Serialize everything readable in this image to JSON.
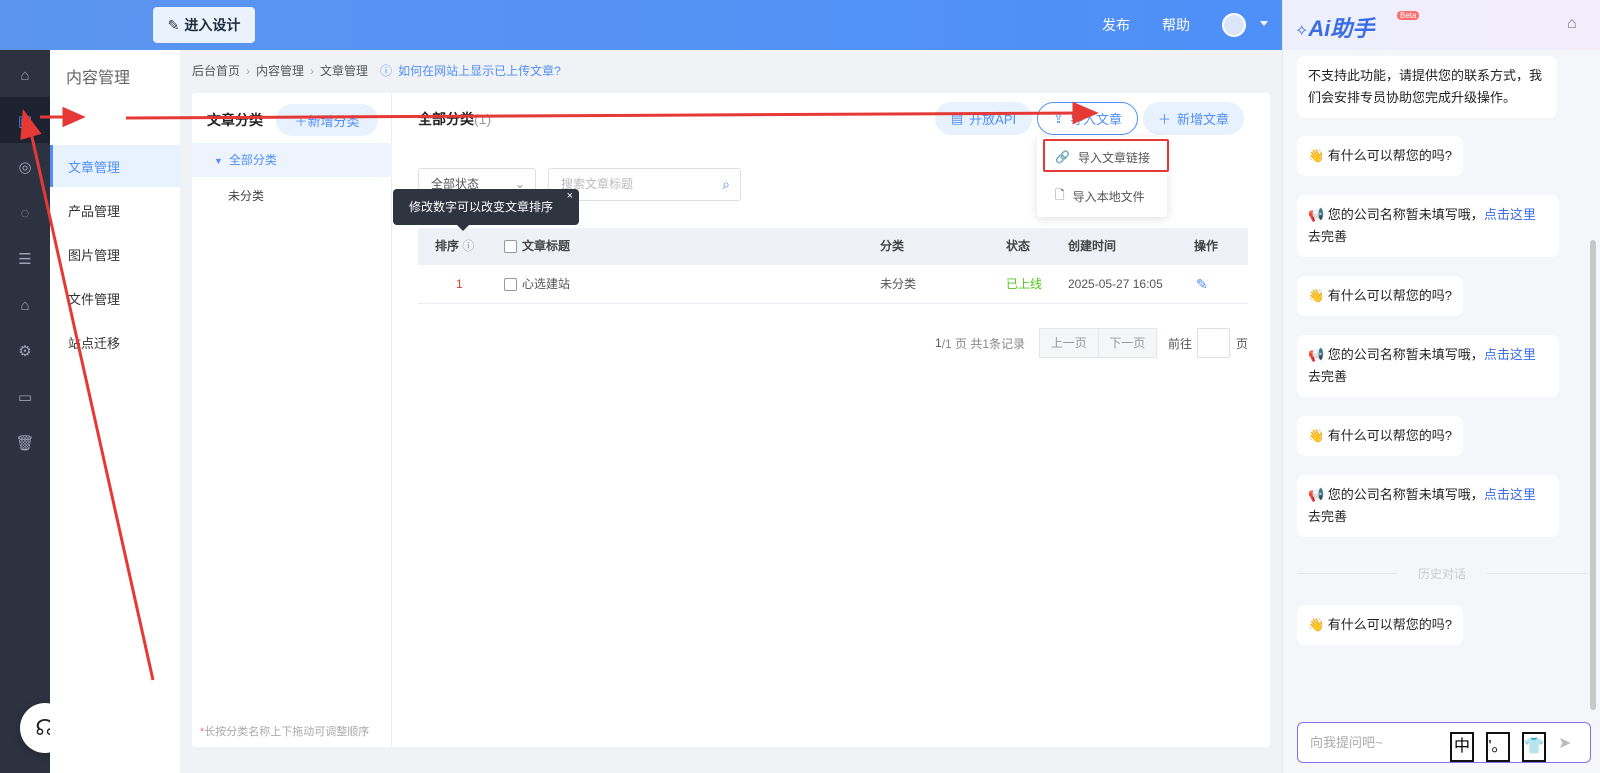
{
  "topbar": {
    "design_label": "进入设计",
    "publish": "发布",
    "help": "帮助"
  },
  "submenu": {
    "title": "内容管理",
    "items": [
      "文章管理",
      "产品管理",
      "图片管理",
      "文件管理",
      "站点迁移"
    ]
  },
  "breadcrumb": {
    "items": [
      "后台首页",
      "内容管理",
      "文章管理"
    ],
    "help": "如何在网站上显示已上传文章?"
  },
  "category": {
    "title": "文章分类",
    "add_label": "新增分类",
    "all": "全部分类",
    "uncategorized": "未分类",
    "hint_star": "*",
    "hint": "长按分类名称上下拖动可调整顺序"
  },
  "main": {
    "title": "全部分类",
    "count": "(1)",
    "btn_api": "开放API",
    "btn_import": "导入文章",
    "btn_add": "新增文章",
    "dropdown": [
      "导入文章链接",
      "导入本地文件"
    ],
    "status_select": "全部状态",
    "search_placeholder": "搜索文章标题",
    "tooltip": "修改数字可以改变文章排序",
    "tooltip_close": "×"
  },
  "table": {
    "headers": {
      "order": "排序",
      "title": "文章标题",
      "category": "分类",
      "status": "状态",
      "created": "创建时间",
      "action": "操作"
    },
    "rows": [
      {
        "order": "1",
        "title": "心选建站",
        "category": "未分类",
        "status": "已上线",
        "created": "2025-05-27 16:05"
      }
    ]
  },
  "pager": {
    "current": "1",
    "total_text": "/1 页 共1条记录",
    "prev": "上一页",
    "next": "下一页",
    "goto": "前往",
    "unit": "页"
  },
  "ai": {
    "logo": "Ai助手",
    "beta": "Beta",
    "messages": [
      {
        "text": "不支持此功能，请提供您的联系方式，我们会安排专员协助您完成升级操作。"
      },
      {
        "text": "👋 有什么可以帮您的吗?"
      },
      {
        "text": "📢 您的公司名称暂未填写哦，",
        "link": "点击这里",
        "tail": " 去完善"
      },
      {
        "text": "👋 有什么可以帮您的吗?"
      },
      {
        "text": "📢 您的公司名称暂未填写哦，",
        "link": "点击这里",
        "tail": " 去完善"
      },
      {
        "text": "👋 有什么可以帮您的吗?"
      },
      {
        "text": "📢 您的公司名称暂未填写哦，",
        "link": "点击这里",
        "tail": " 去完善"
      },
      {
        "text": "👋 有什么可以帮您的吗?"
      }
    ],
    "history": "历史对话",
    "input_placeholder": "向我提问吧~",
    "ime": [
      "中",
      "'。",
      "👕"
    ]
  },
  "colors": {
    "accent": "#4f8ff7",
    "annotation": "#e53935",
    "online": "#52c41a",
    "order_number": "#e53935"
  }
}
